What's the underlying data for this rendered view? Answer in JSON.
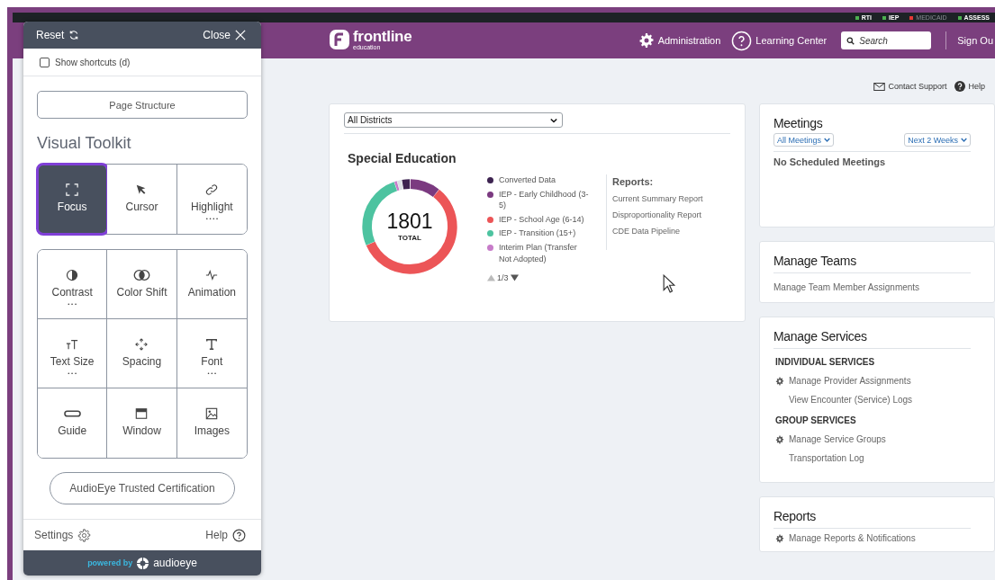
{
  "status_strip": [
    {
      "label": "RTI",
      "color": "#4caf50",
      "disabled": false
    },
    {
      "label": "IEP",
      "color": "#4caf50",
      "disabled": false
    },
    {
      "label": "MEDICAID",
      "color": "#e53935",
      "disabled": true
    },
    {
      "label": "ASSESS",
      "color": "#4caf50",
      "disabled": false
    }
  ],
  "header": {
    "logo": {
      "name": "frontline",
      "sub": "education"
    },
    "administration": "Administration",
    "learning_center": "Learning Center",
    "search": {
      "placeholder": "Search"
    },
    "sign_out": "Sign Ou"
  },
  "toolkit": {
    "reset": "Reset",
    "close": "Close",
    "shortcuts": {
      "label": "Show shortcuts (d)",
      "checked": false
    },
    "page_structure": "Page Structure",
    "heading": "Visual Toolkit",
    "groups": [
      {
        "tools": [
          {
            "kind": "focus",
            "label": "Focus",
            "selected": true
          },
          {
            "kind": "cursor",
            "label": "Cursor",
            "selected": false
          },
          {
            "kind": "highlight",
            "label": "Highlight",
            "selected": false,
            "dots": "• • • •"
          }
        ]
      },
      {
        "tools": [
          {
            "kind": "contrast",
            "label": "Contrast",
            "selected": false,
            "dots": "• • •"
          },
          {
            "kind": "color_shift",
            "label": "Color Shift",
            "selected": false
          },
          {
            "kind": "animation",
            "label": "Animation",
            "selected": false
          },
          {
            "kind": "text_size",
            "label": "Text Size",
            "selected": false,
            "dots": "• • •"
          },
          {
            "kind": "spacing",
            "label": "Spacing",
            "selected": false
          },
          {
            "kind": "font",
            "label": "Font",
            "selected": false,
            "dots": "• • •"
          },
          {
            "kind": "guide",
            "label": "Guide",
            "selected": false
          },
          {
            "kind": "window",
            "label": "Window",
            "selected": false
          },
          {
            "kind": "images",
            "label": "Images",
            "selected": false
          }
        ]
      }
    ],
    "certification": "AudioEye Trusted Certification",
    "settings": "Settings",
    "help": "Help",
    "powered_by": "powered by",
    "brand": "audioeye"
  },
  "top_links": {
    "contact_support": "Contact Support",
    "help": "Help"
  },
  "special_education": {
    "district_select": "All Districts",
    "title": "Special Education",
    "total": "1801",
    "total_label": "TOTAL",
    "legend": [
      {
        "label": "Converted Data",
        "color": "#3d2350"
      },
      {
        "label": "IEP - Early Childhood (3-5)",
        "color": "#7b3a80"
      },
      {
        "label": "IEP - School Age (6-14)",
        "color": "#ec5557"
      },
      {
        "label": "IEP - Transition (15+)",
        "color": "#4dc3a0"
      },
      {
        "label": "Interim Plan (Transfer Not Adopted)",
        "color": "#c77cc9"
      }
    ],
    "pager": "1/3",
    "reports_heading": "Reports:",
    "reports": [
      "Current Summary Report",
      "Disproportionality Report",
      "CDE Data Pipeline"
    ]
  },
  "meetings": {
    "title": "Meetings",
    "filter": "All Meetings",
    "range": "Next 2 Weeks",
    "empty": "No Scheduled Meetings"
  },
  "manage_teams": {
    "title": "Manage Teams",
    "links": [
      "Manage Team Member Assignments"
    ]
  },
  "manage_services": {
    "title": "Manage Services",
    "sections": [
      {
        "heading": "INDIVIDUAL SERVICES",
        "links": [
          {
            "label": "Manage Provider Assignments",
            "gear": true
          },
          {
            "label": "View Encounter (Service) Logs",
            "gear": false
          }
        ]
      },
      {
        "heading": "GROUP SERVICES",
        "links": [
          {
            "label": "Manage Service Groups",
            "gear": true
          },
          {
            "label": "Transportation Log",
            "gear": false
          }
        ]
      }
    ]
  },
  "reports": {
    "title": "Reports",
    "links": [
      {
        "label": "Manage Reports & Notifications",
        "gear": true
      }
    ]
  }
}
